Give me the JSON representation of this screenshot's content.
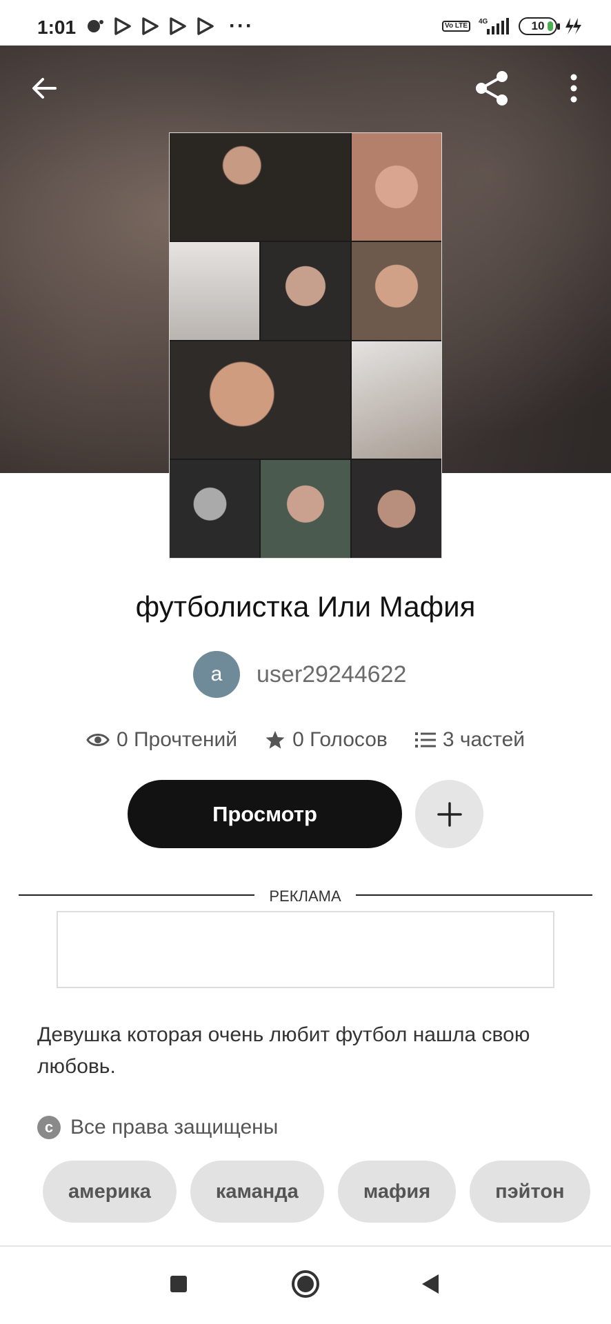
{
  "status_bar": {
    "time": "1:01",
    "network": "4G",
    "volte": "Vo LTE",
    "battery": "10",
    "more_indicator": "···"
  },
  "header": {
    "back_icon": "arrow-left-icon",
    "share_icon": "share-icon",
    "more_icon": "more-vertical-icon"
  },
  "story": {
    "title": "футболистка Или Мафия",
    "author_initial": "a",
    "author": "user29244622",
    "stats": {
      "reads": "0 Прочтений",
      "votes": "0 Голосов",
      "parts": "3 частей"
    },
    "view_button": "Просмотр",
    "ad_label": "РЕКЛАМА",
    "description": "Девушка которая очень любит футбол нашла свою любовь.",
    "rights": "Все права защищены",
    "tags": [
      "америка",
      "каманда",
      "мафия",
      "пэйтон"
    ]
  },
  "colors": {
    "primary_button": "#121212",
    "avatar": "#6f8a99",
    "tag_bg": "#e2e2e2"
  }
}
